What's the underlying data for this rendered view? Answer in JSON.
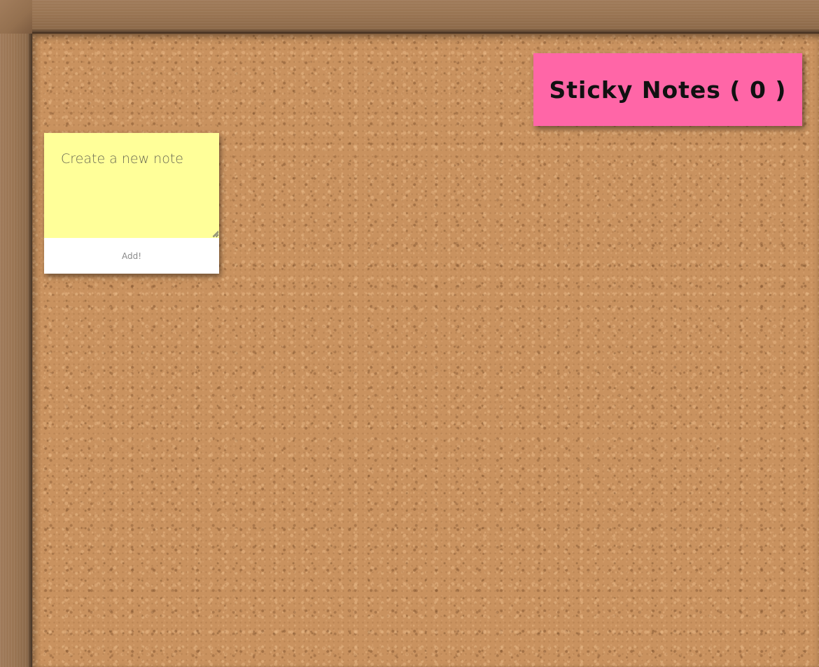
{
  "board": {
    "title": "Sticky Notes ( 0 )",
    "note_count": 0
  },
  "composer": {
    "placeholder": "Create a new note",
    "value": "",
    "add_label": "Add!"
  },
  "colors": {
    "title_badge": "#ff66a7",
    "note": "#ffff99",
    "cork": "#c9925f",
    "frame": "#9a7553"
  },
  "icons": [
    "resize-grip-icon"
  ]
}
